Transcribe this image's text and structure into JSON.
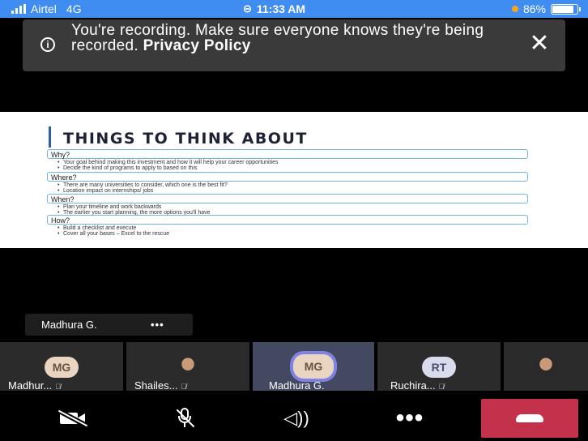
{
  "status_bar": {
    "carrier": "Airtel",
    "network": "4G",
    "time": "11:33 AM",
    "battery": "86%",
    "battery_level": 0.86
  },
  "banner": {
    "message": "You're recording. Make sure everyone knows they're being recorded.",
    "link": "Privacy Policy",
    "close_icon": "close-icon"
  },
  "slide": {
    "title": "THINGS TO THINK ABOUT",
    "sections": [
      {
        "heading": "Why?",
        "bullets": [
          "Your goal behind making this investment and how it will help your career opportunities",
          "Decide the kind of programs to apply to based on this"
        ]
      },
      {
        "heading": "Where?",
        "bullets": [
          "There are many universities to consider, which one is the best fit?",
          "Location impact on internships/ jobs"
        ]
      },
      {
        "heading": "When?",
        "bullets": [
          "Plan your timeline and work backwards",
          "The earlier you start planning, the more options you'll have"
        ]
      },
      {
        "heading": "How?",
        "bullets": [
          "Build a checklist and execute",
          "Cover all your bases – Excel to the rescue"
        ]
      }
    ]
  },
  "active_speaker": {
    "name": "Madhura G.",
    "more": "•••"
  },
  "participants": [
    {
      "initials": "MG",
      "label": "Madhur..."
    },
    {
      "initials": "",
      "label": "Shailes..."
    },
    {
      "initials": "MG",
      "label": "Madhura G."
    },
    {
      "initials": "RT",
      "label": "Ruchira..."
    },
    {
      "initials": "",
      "label": ""
    }
  ],
  "controls": {
    "camera": "camera-off-icon",
    "mic": "mic-off-icon",
    "audio": "speaker-icon",
    "more": "•••",
    "hangup": "hangup-icon",
    "hangup_color": "#c4314b"
  }
}
